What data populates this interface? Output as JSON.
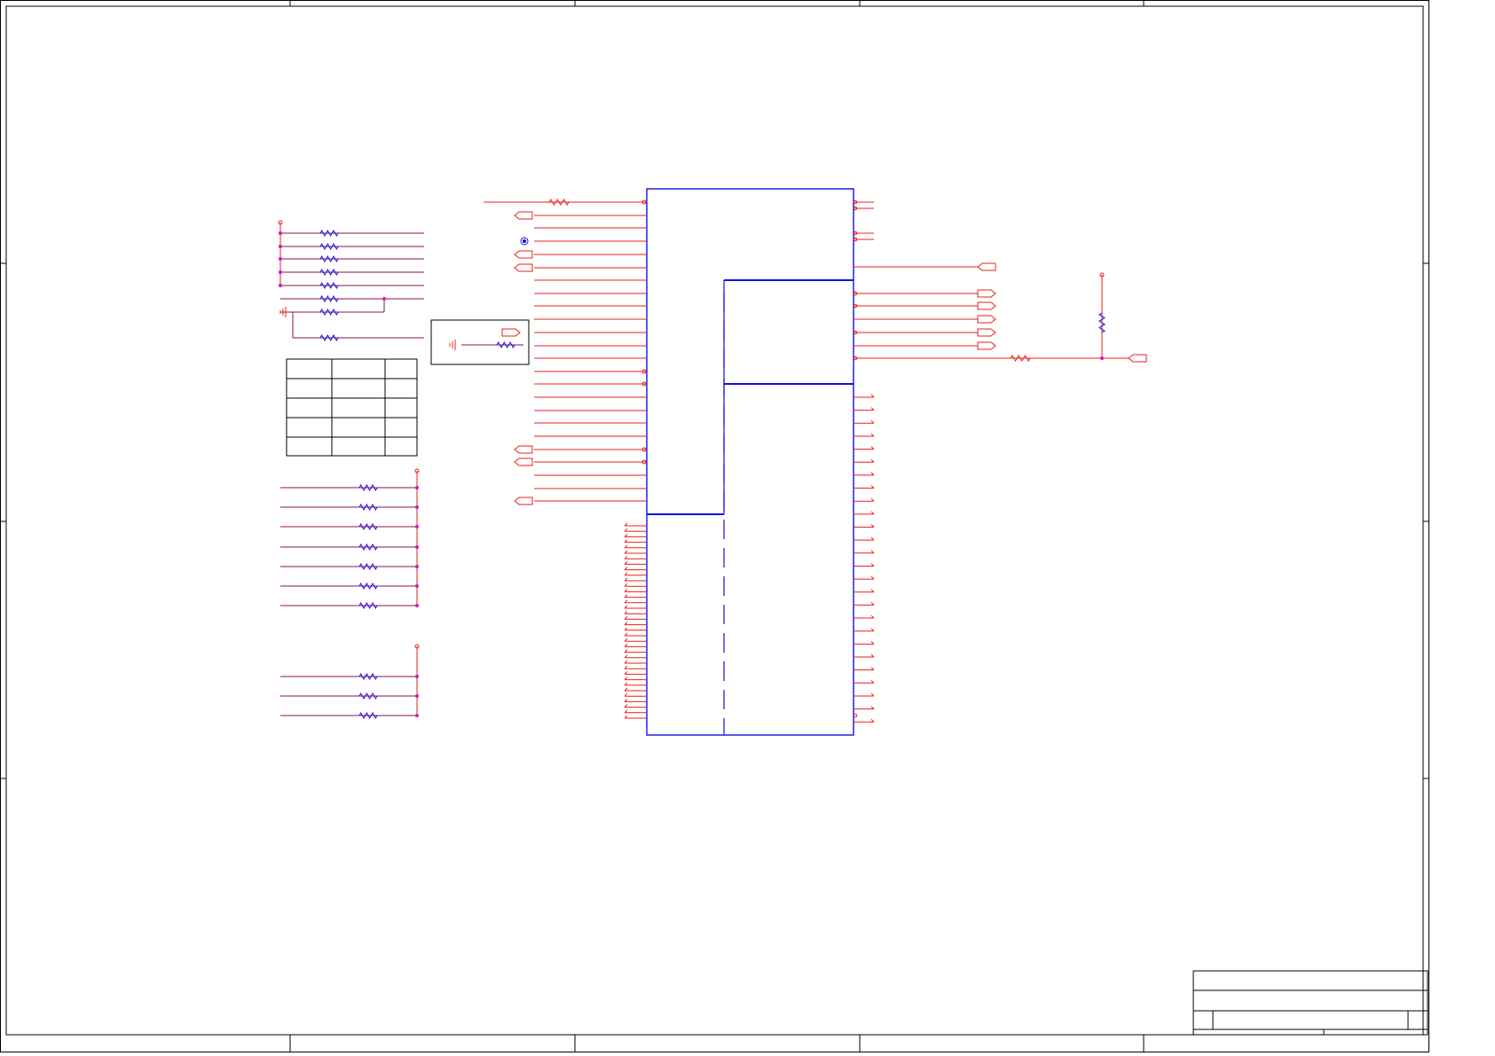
{
  "title_block": {
    "title": "",
    "size": "",
    "document_number": "",
    "revision": "",
    "date": "",
    "sheet": ""
  },
  "colors": {
    "wire": "#e8201c",
    "bus": "#1010e0",
    "net": "#8a1050",
    "frame": "#000000",
    "junction": "#d020c0",
    "background": "#ffffff"
  },
  "config_table": {
    "rows": 5,
    "cells": [
      [
        "",
        "",
        ""
      ],
      [
        "",
        "",
        ""
      ],
      [
        "",
        "",
        ""
      ],
      [
        "",
        "",
        ""
      ],
      [
        "",
        "",
        ""
      ]
    ]
  },
  "icons": [
    "ground-icon",
    "resistor-icon",
    "power-port-icon",
    "offpage-connector-icon",
    "test-point-icon"
  ]
}
